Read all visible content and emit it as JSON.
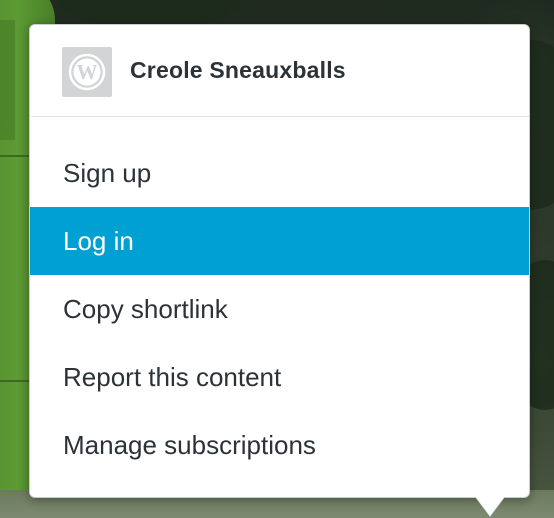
{
  "site": {
    "title": "Creole Sneauxballs",
    "icon": "wordpress-icon"
  },
  "menu": {
    "items": [
      {
        "label": "Sign up",
        "active": false
      },
      {
        "label": "Log in",
        "active": true
      },
      {
        "label": "Copy shortlink",
        "active": false
      },
      {
        "label": "Report this content",
        "active": false
      },
      {
        "label": "Manage subscriptions",
        "active": false
      }
    ]
  },
  "colors": {
    "accent": "#00a0d2",
    "text": "#2c3338",
    "icon_bg": "#d2d4d6"
  }
}
